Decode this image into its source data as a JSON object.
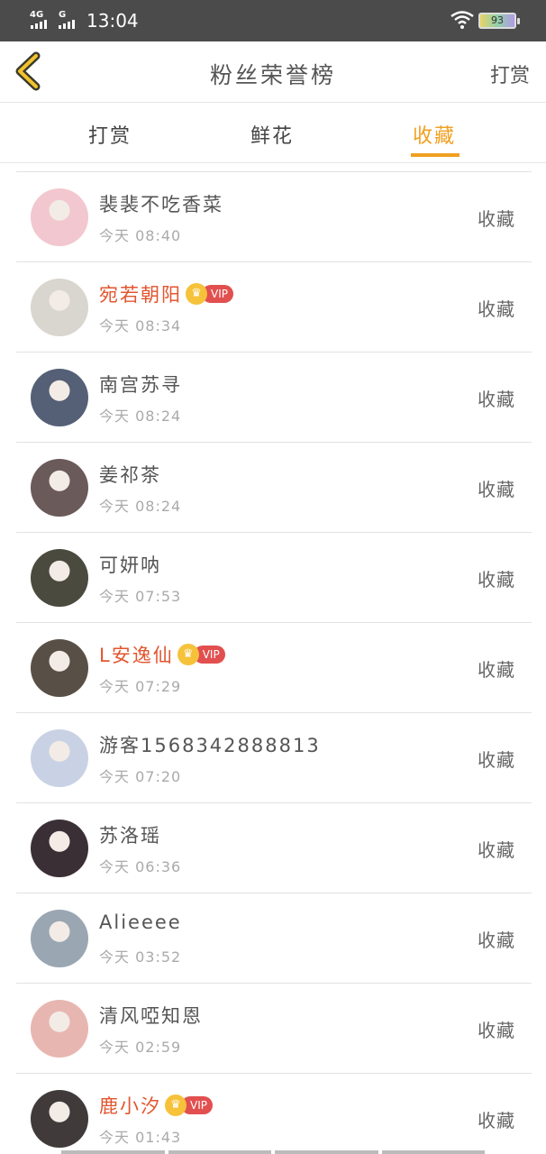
{
  "status_bar": {
    "signal_1": "4G",
    "signal_2": "G",
    "time": "13:04",
    "battery": "93"
  },
  "header": {
    "title": "粉丝荣誉榜",
    "right_action": "打赏"
  },
  "tabs": [
    {
      "label": "打赏",
      "active": false
    },
    {
      "label": "鲜花",
      "active": false
    },
    {
      "label": "收藏",
      "active": true
    }
  ],
  "vip_badge_label": "VIP",
  "rows": [
    {
      "name": "裴裴不吃香菜",
      "time": "今天 08:40",
      "vip": false,
      "action": "收藏",
      "avatar_color": "#f2c7cf"
    },
    {
      "name": "宛若朝阳",
      "time": "今天 08:34",
      "vip": true,
      "action": "收藏",
      "avatar_color": "#d9d6cf"
    },
    {
      "name": "南宫苏寻",
      "time": "今天 08:24",
      "vip": false,
      "action": "收藏",
      "avatar_color": "#556077"
    },
    {
      "name": "姜祁茶",
      "time": "今天 08:24",
      "vip": false,
      "action": "收藏",
      "avatar_color": "#6b5a5a"
    },
    {
      "name": "可妍呐",
      "time": "今天 07:53",
      "vip": false,
      "action": "收藏",
      "avatar_color": "#4a4a3e"
    },
    {
      "name": "L安逸仙",
      "time": "今天 07:29",
      "vip": true,
      "action": "收藏",
      "avatar_color": "#585046"
    },
    {
      "name": "游客1568342888813",
      "time": "今天 07:20",
      "vip": false,
      "action": "收藏",
      "avatar_color": "#c9d2e4"
    },
    {
      "name": "苏洛瑶",
      "time": "今天 06:36",
      "vip": false,
      "action": "收藏",
      "avatar_color": "#3b2f36"
    },
    {
      "name": "Alieeee",
      "time": "今天 03:52",
      "vip": false,
      "action": "收藏",
      "avatar_color": "#9ba6b3"
    },
    {
      "name": "清风啞知恩",
      "time": "今天 02:59",
      "vip": false,
      "action": "收藏",
      "avatar_color": "#e8b6b0"
    },
    {
      "name": "鹿小汐",
      "time": "今天 01:43",
      "vip": true,
      "action": "收藏",
      "avatar_color": "#403a3a"
    }
  ],
  "colors": {
    "accent": "#f0a020",
    "vip_name": "#e2552f",
    "vip_badge": "#e24f4f",
    "crown": "#f5c23a"
  }
}
